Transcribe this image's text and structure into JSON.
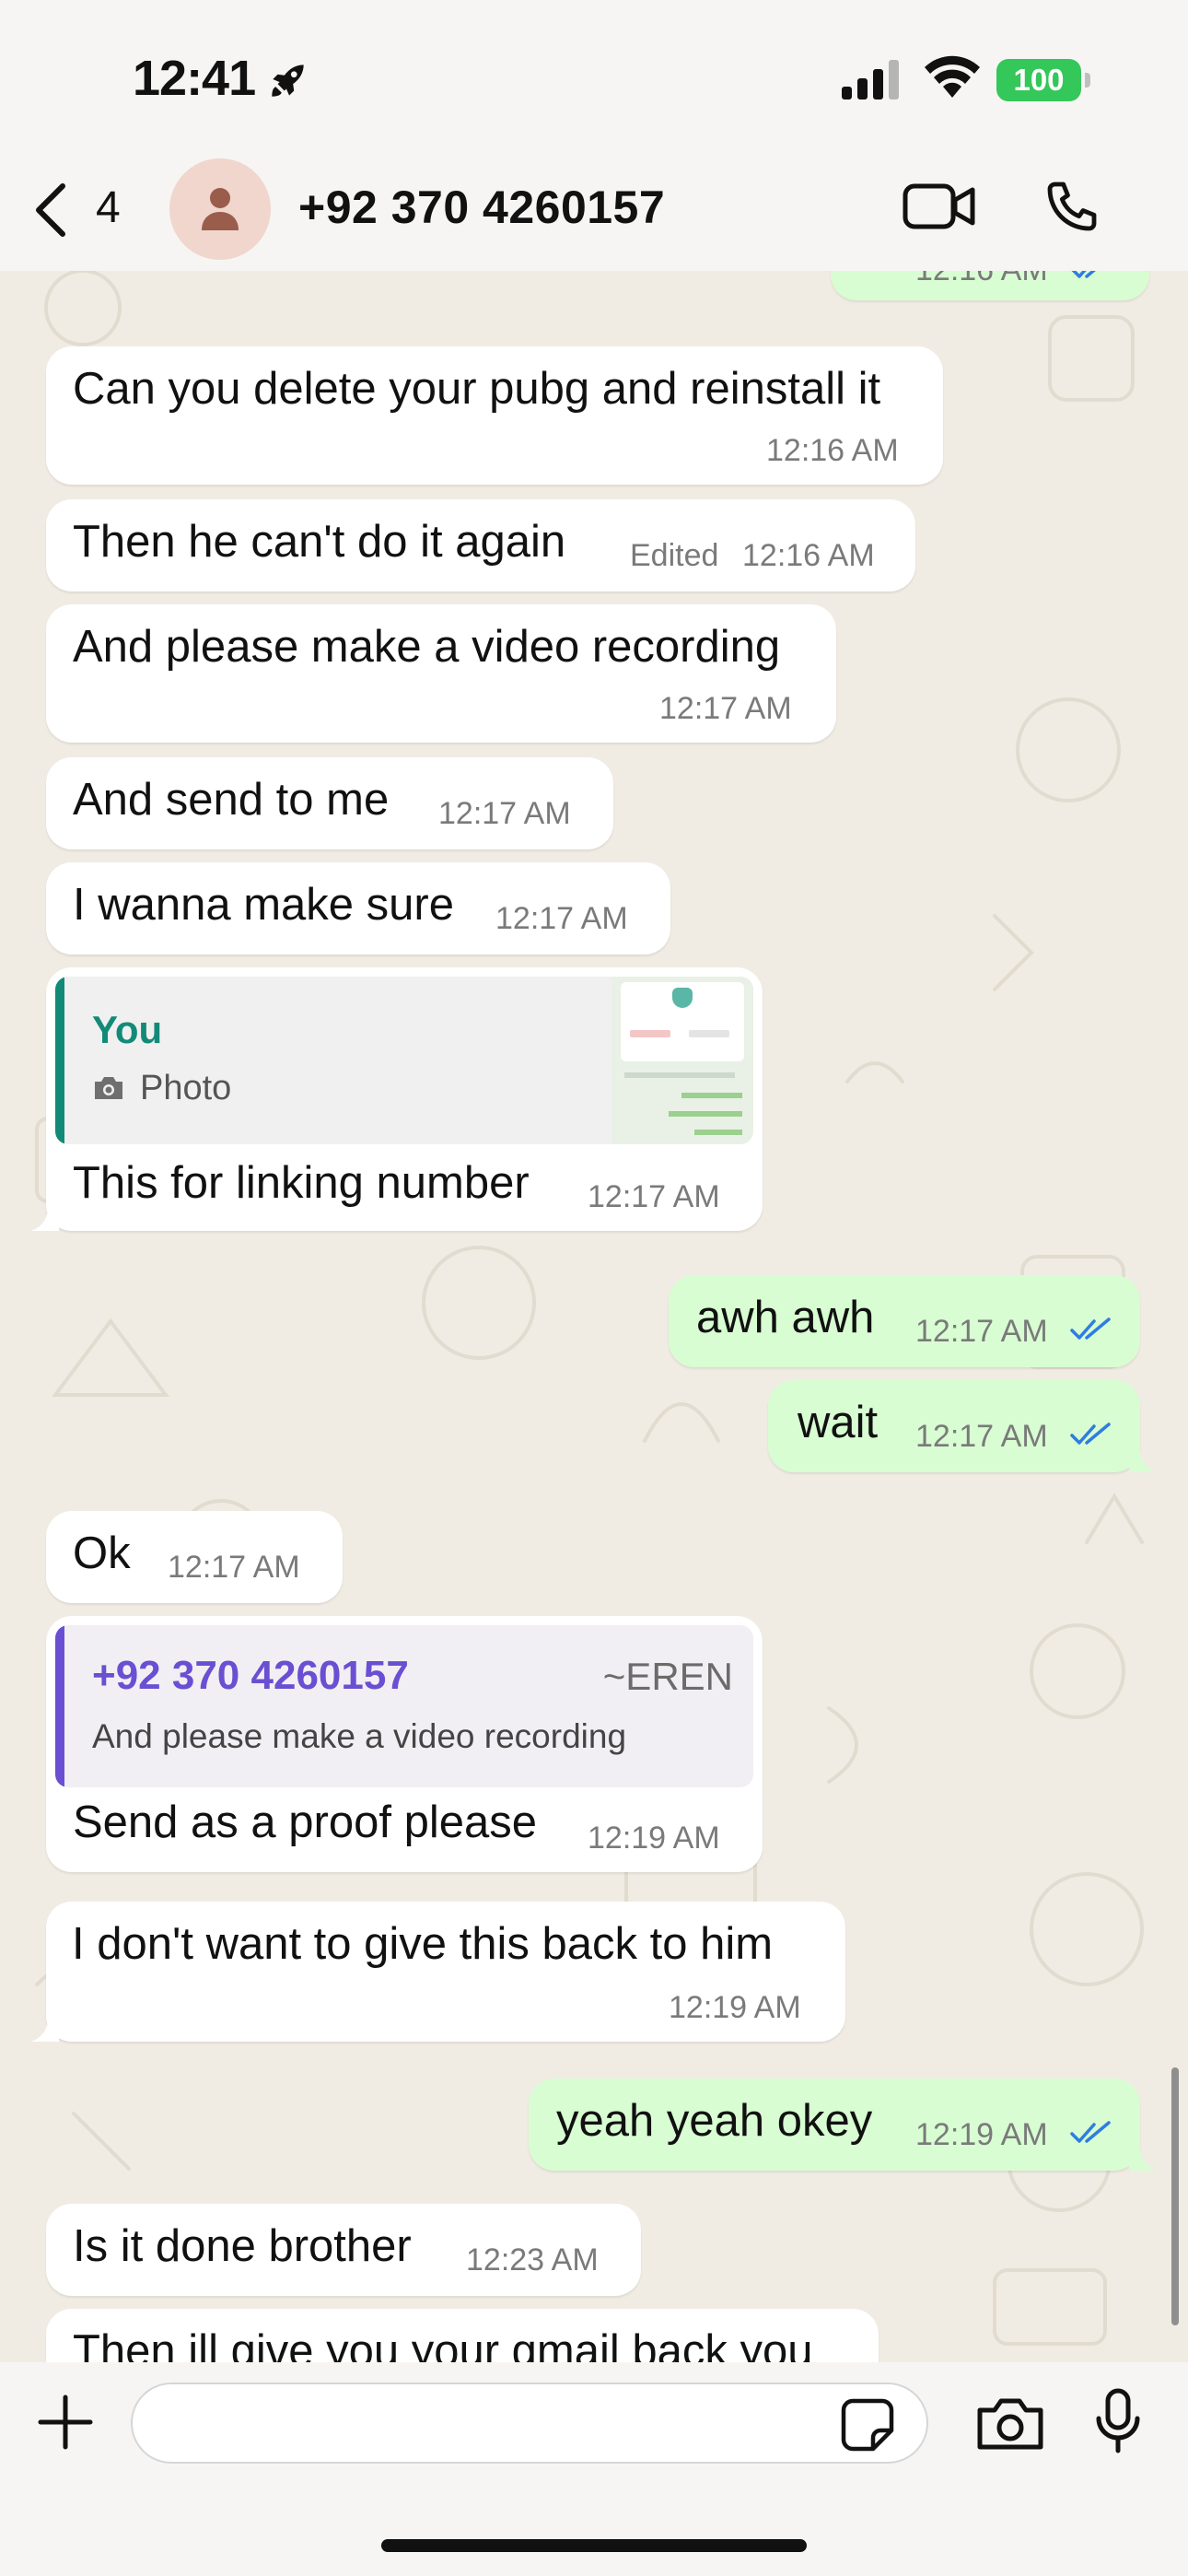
{
  "status_bar": {
    "time": "12:41",
    "battery": "100"
  },
  "header": {
    "back_count": "4",
    "contact_name": "+92 370 4260157"
  },
  "messages": [
    {
      "text": "",
      "time": "12:16 AM"
    },
    {
      "text": "Can you delete your pubg and reinstall it",
      "time": "12:16 AM"
    },
    {
      "text": "Then he can't do it again",
      "edited": "Edited",
      "time": "12:16 AM"
    },
    {
      "text": "And please make a video recording",
      "time": "12:17 AM"
    },
    {
      "text": "And send to me",
      "time": "12:17 AM"
    },
    {
      "text": "I wanna make sure",
      "time": "12:17 AM"
    },
    {
      "text": "This for linking number",
      "time": "12:17 AM",
      "quote_author": "You",
      "quote_text": "Photo"
    },
    {
      "text": "awh awh",
      "time": "12:17 AM"
    },
    {
      "text": "wait",
      "time": "12:17 AM"
    },
    {
      "text": "Ok",
      "time": "12:17 AM"
    },
    {
      "text": "Send as a proof please",
      "time": "12:19 AM",
      "quote_author": "+92 370 4260157",
      "quote_alias": "~EREN",
      "quote_text": "And please make a video recording"
    },
    {
      "text": "I don't want to give this back to him",
      "time": "12:19 AM"
    },
    {
      "text": "yeah yeah okey",
      "time": "12:19 AM"
    },
    {
      "text": "Is it done brother",
      "time": "12:23 AM"
    },
    {
      "text": "Then ill give you your gmail back you",
      "time": ""
    }
  ],
  "colors": {
    "incoming_bubble": "#ffffff",
    "outgoing_bubble": "#d8fdd2",
    "read_ticks": "#2f7de1",
    "you_quote": "#138a78",
    "contact_quote": "#6a4fd2",
    "battery": "#34c759"
  }
}
